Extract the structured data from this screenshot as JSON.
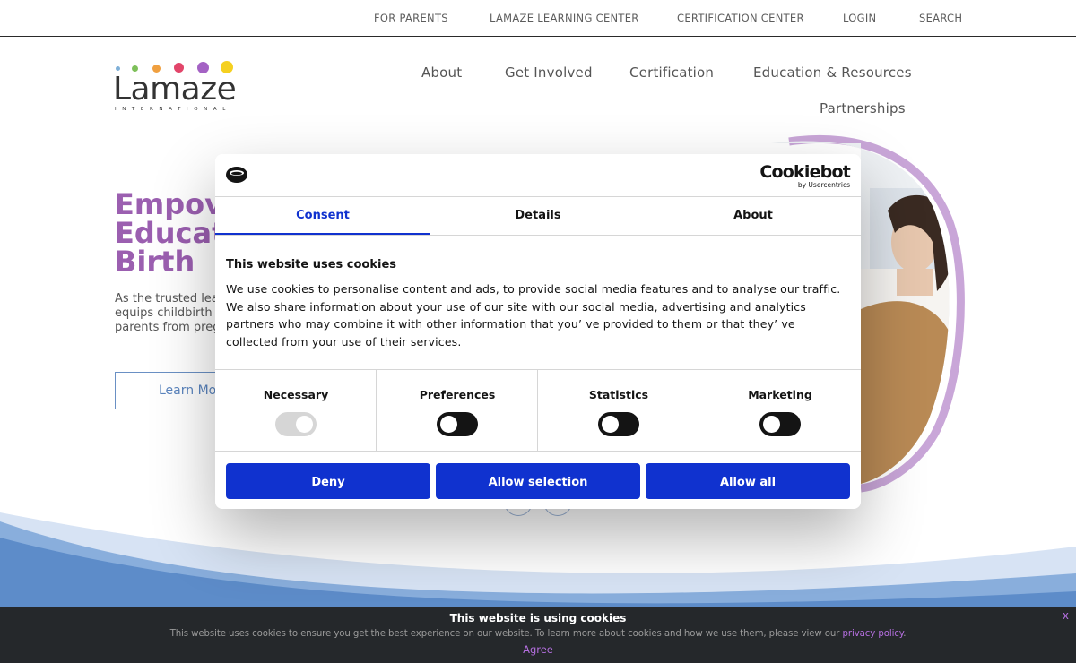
{
  "top_nav": {
    "items": [
      {
        "label": "FOR PARENTS"
      },
      {
        "label": "LAMAZE LEARNING CENTER"
      },
      {
        "label": "CERTIFICATION CENTER"
      },
      {
        "label": "LOGIN"
      },
      {
        "label": "SEARCH"
      }
    ]
  },
  "logo": {
    "name": "Lamaze",
    "sub": "INTERNATIONAL",
    "dot_colors": [
      "#7fb0d8",
      "#7ec05a",
      "#f0a040",
      "#e2456a",
      "#a462c4",
      "#f5d020"
    ]
  },
  "main_nav": {
    "items": [
      {
        "label": "About"
      },
      {
        "label": "Get Involved"
      },
      {
        "label": "Certification"
      },
      {
        "label": "Education & Resources"
      },
      {
        "label": "Partnerships"
      }
    ]
  },
  "hero": {
    "title_lines": [
      "Empov",
      "Educat",
      "Birth"
    ],
    "text_lines": [
      "As the trusted lea",
      "equips childbirth",
      "parents from preg"
    ],
    "button_label": "Learn Mo"
  },
  "cookiebot": {
    "brand": "Cookiebot",
    "brand_sub": "by Usercentrics",
    "tabs": [
      {
        "label": "Consent",
        "active": true
      },
      {
        "label": "Details",
        "active": false
      },
      {
        "label": "About",
        "active": false
      }
    ],
    "title": "This website uses cookies",
    "description": "We use cookies to personalise content and ads, to provide social media features and to analyse our traffic. We also share information about your use of our site with our social media, advertising and analytics partners who may combine it with other information that you’ ve provided to them or that they’ ve collected from your use of their services.",
    "categories": [
      {
        "label": "Necessary",
        "enabled": true,
        "disabled": true
      },
      {
        "label": "Preferences",
        "enabled": false
      },
      {
        "label": "Statistics",
        "enabled": false
      },
      {
        "label": "Marketing",
        "enabled": false
      }
    ],
    "buttons": {
      "deny": "Deny",
      "allow_selection": "Allow selection",
      "allow_all": "Allow all"
    },
    "accent_color": "#1032cf"
  },
  "cookie_bar": {
    "title": "This website is using cookies",
    "text": "This website uses cookies to ensure you get the best experience on our website. To learn more about cookies and how we use them, please view our",
    "link_label": "privacy policy",
    "period": ".",
    "agree_label": "Agree",
    "close_label": "x"
  }
}
